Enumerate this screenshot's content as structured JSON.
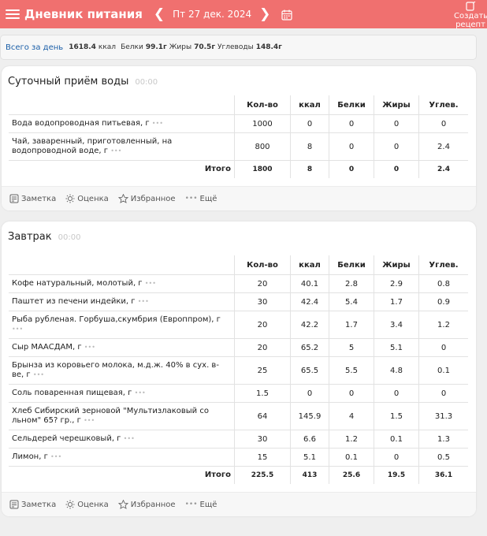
{
  "header": {
    "title": "Дневник питания",
    "date": "Пт 27 дек. 2024",
    "create_line1": "Создать",
    "create_line2": "рецепт"
  },
  "totals": {
    "label": "Всего за день",
    "kcal_value": "1618.4",
    "kcal_unit": "ккал",
    "protein_label": "Белки",
    "protein_value": "99.1г",
    "fat_label": "Жиры",
    "fat_value": "70.5г",
    "carbs_label": "Углеводы",
    "carbs_value": "148.4г"
  },
  "columns": [
    "Кол-во",
    "ккал",
    "Белки",
    "Жиры",
    "Углев."
  ],
  "actions": [
    "Заметка",
    "Оценка",
    "Избранное",
    "Ещё"
  ],
  "water": {
    "title": "Суточный приём воды",
    "time": "00:00",
    "rows": [
      {
        "name": "Вода водопроводная питьевая, г",
        "qty": "1000",
        "kcal": "0",
        "protein": "0",
        "fat": "0",
        "carbs": "0"
      },
      {
        "name": "Чай, заваренный, приготовленный, на водопроводной воде, г",
        "qty": "800",
        "kcal": "8",
        "protein": "0",
        "fat": "0",
        "carbs": "2.4"
      }
    ],
    "total": {
      "label": "Итого",
      "qty": "1800",
      "kcal": "8",
      "protein": "0",
      "fat": "0",
      "carbs": "2.4"
    }
  },
  "breakfast": {
    "title": "Завтрак",
    "time": "00:00",
    "rows": [
      {
        "name": "Кофе натуральный, молотый, г",
        "qty": "20",
        "kcal": "40.1",
        "protein": "2.8",
        "fat": "2.9",
        "carbs": "0.8"
      },
      {
        "name": "Паштет из печени индейки, г",
        "qty": "30",
        "kcal": "42.4",
        "protein": "5.4",
        "fat": "1.7",
        "carbs": "0.9"
      },
      {
        "name": "Рыба рубленая. Горбуша,скумбрия (Европпром), г",
        "qty": "20",
        "kcal": "42.2",
        "protein": "1.7",
        "fat": "3.4",
        "carbs": "1.2"
      },
      {
        "name": "Сыр МААСДАМ, г",
        "qty": "20",
        "kcal": "65.2",
        "protein": "5",
        "fat": "5.1",
        "carbs": "0"
      },
      {
        "name": "Брынза из коровьего молока, м.д.ж. 40% в сух. в-ве, г",
        "qty": "25",
        "kcal": "65.5",
        "protein": "5.5",
        "fat": "4.8",
        "carbs": "0.1"
      },
      {
        "name": "Соль поваренная пищевая, г",
        "qty": "1.5",
        "kcal": "0",
        "protein": "0",
        "fat": "0",
        "carbs": "0"
      },
      {
        "name": "Хлеб Сибирский зерновой \"Мультизлаковый со льном\" 65? гр., г",
        "qty": "64",
        "kcal": "145.9",
        "protein": "4",
        "fat": "1.5",
        "carbs": "31.3"
      },
      {
        "name": "Сельдерей черешковый, г",
        "qty": "30",
        "kcal": "6.6",
        "protein": "1.2",
        "fat": "0.1",
        "carbs": "1.3"
      },
      {
        "name": "Лимон, г",
        "qty": "15",
        "kcal": "5.1",
        "protein": "0.1",
        "fat": "0",
        "carbs": "0.5"
      }
    ],
    "total": {
      "label": "Итого",
      "qty": "225.5",
      "kcal": "413",
      "protein": "25.6",
      "fat": "19.5",
      "carbs": "36.1"
    }
  },
  "colors": {
    "accent": "#f0706f",
    "link": "#1b5fa8"
  }
}
